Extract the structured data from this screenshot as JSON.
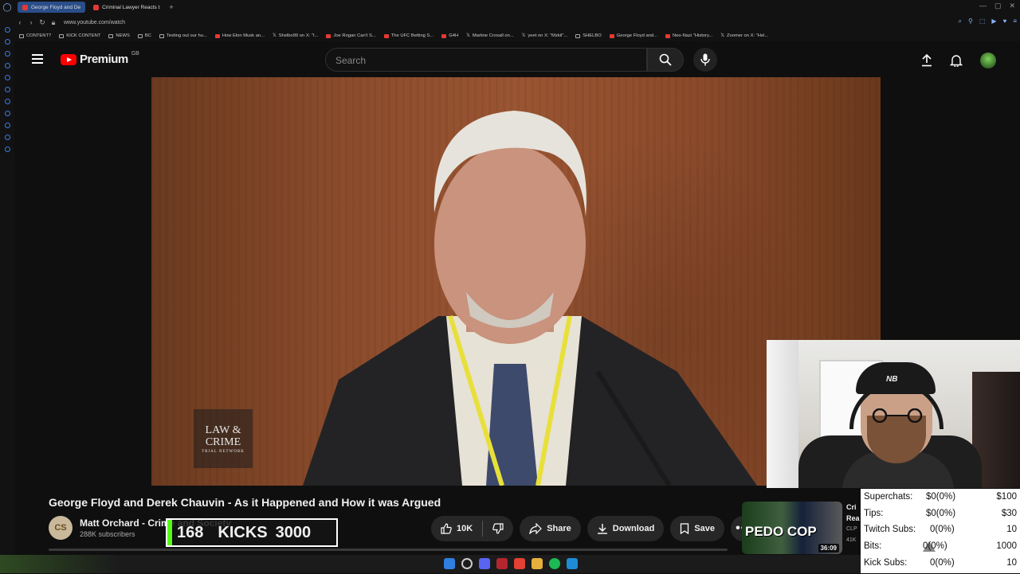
{
  "browser": {
    "tabs": [
      {
        "label": "George Floyd and De",
        "active": true
      },
      {
        "label": "Criminal Lawyer Reacts t",
        "active": false
      }
    ],
    "url": "www.youtube.com/watch",
    "bookmarks": [
      "CONTENT?",
      "KICK CONTENT",
      "NEWS",
      "BC",
      "Testing out our hu...",
      "How Elon Musk an...",
      "Shelbo99 on X: \"I...",
      "Joe Rogan Can't S...",
      "The UFC Betting S...",
      "G4H",
      "Martine Croxall on...",
      "yeet on X: \"Mzkil\"...",
      "SHELBO",
      "George Floyd and...",
      "Neo-Nazi \"History...",
      "Zoomer on X: \"Hel..."
    ]
  },
  "youtube": {
    "logo_text": "Premium",
    "country_code": "GB",
    "search_placeholder": "Search"
  },
  "video": {
    "watermark_line1": "LAW",
    "watermark_amp": "&",
    "watermark_line2": "CRIME",
    "watermark_sub": "TRIAL NETWORK",
    "title": "George Floyd and Derek Chauvin - As it Happened and How it was Argued",
    "channel_initials": "CS",
    "channel_name": "Matt Orchard - Crime and Society",
    "subscribers": "288K subscribers",
    "likes": "10K",
    "share_label": "Share",
    "download_label": "Download",
    "save_label": "Save"
  },
  "kick_overlay": {
    "count": "168",
    "label": "KICKS",
    "goal": "3000"
  },
  "recommended": {
    "thumb_text": "PEDO COP",
    "duration": "36:09",
    "title_fragment": "Cri",
    "title_fragment2": "Rea",
    "meta": "CLP",
    "meta2": "41K"
  },
  "donations": [
    {
      "label": "Superchats:",
      "value": "$0(0%)",
      "goal": "$100"
    },
    {
      "label": "Tips:",
      "value": "$0(0%)",
      "goal": "$30"
    },
    {
      "label": "Twitch Subs:",
      "value": "0(0%)",
      "goal": "10"
    },
    {
      "label": "Bits:",
      "value": "0(0%)",
      "goal": "1000"
    },
    {
      "label": "Kick Subs:",
      "value": "0(0%)",
      "goal": "10"
    }
  ]
}
